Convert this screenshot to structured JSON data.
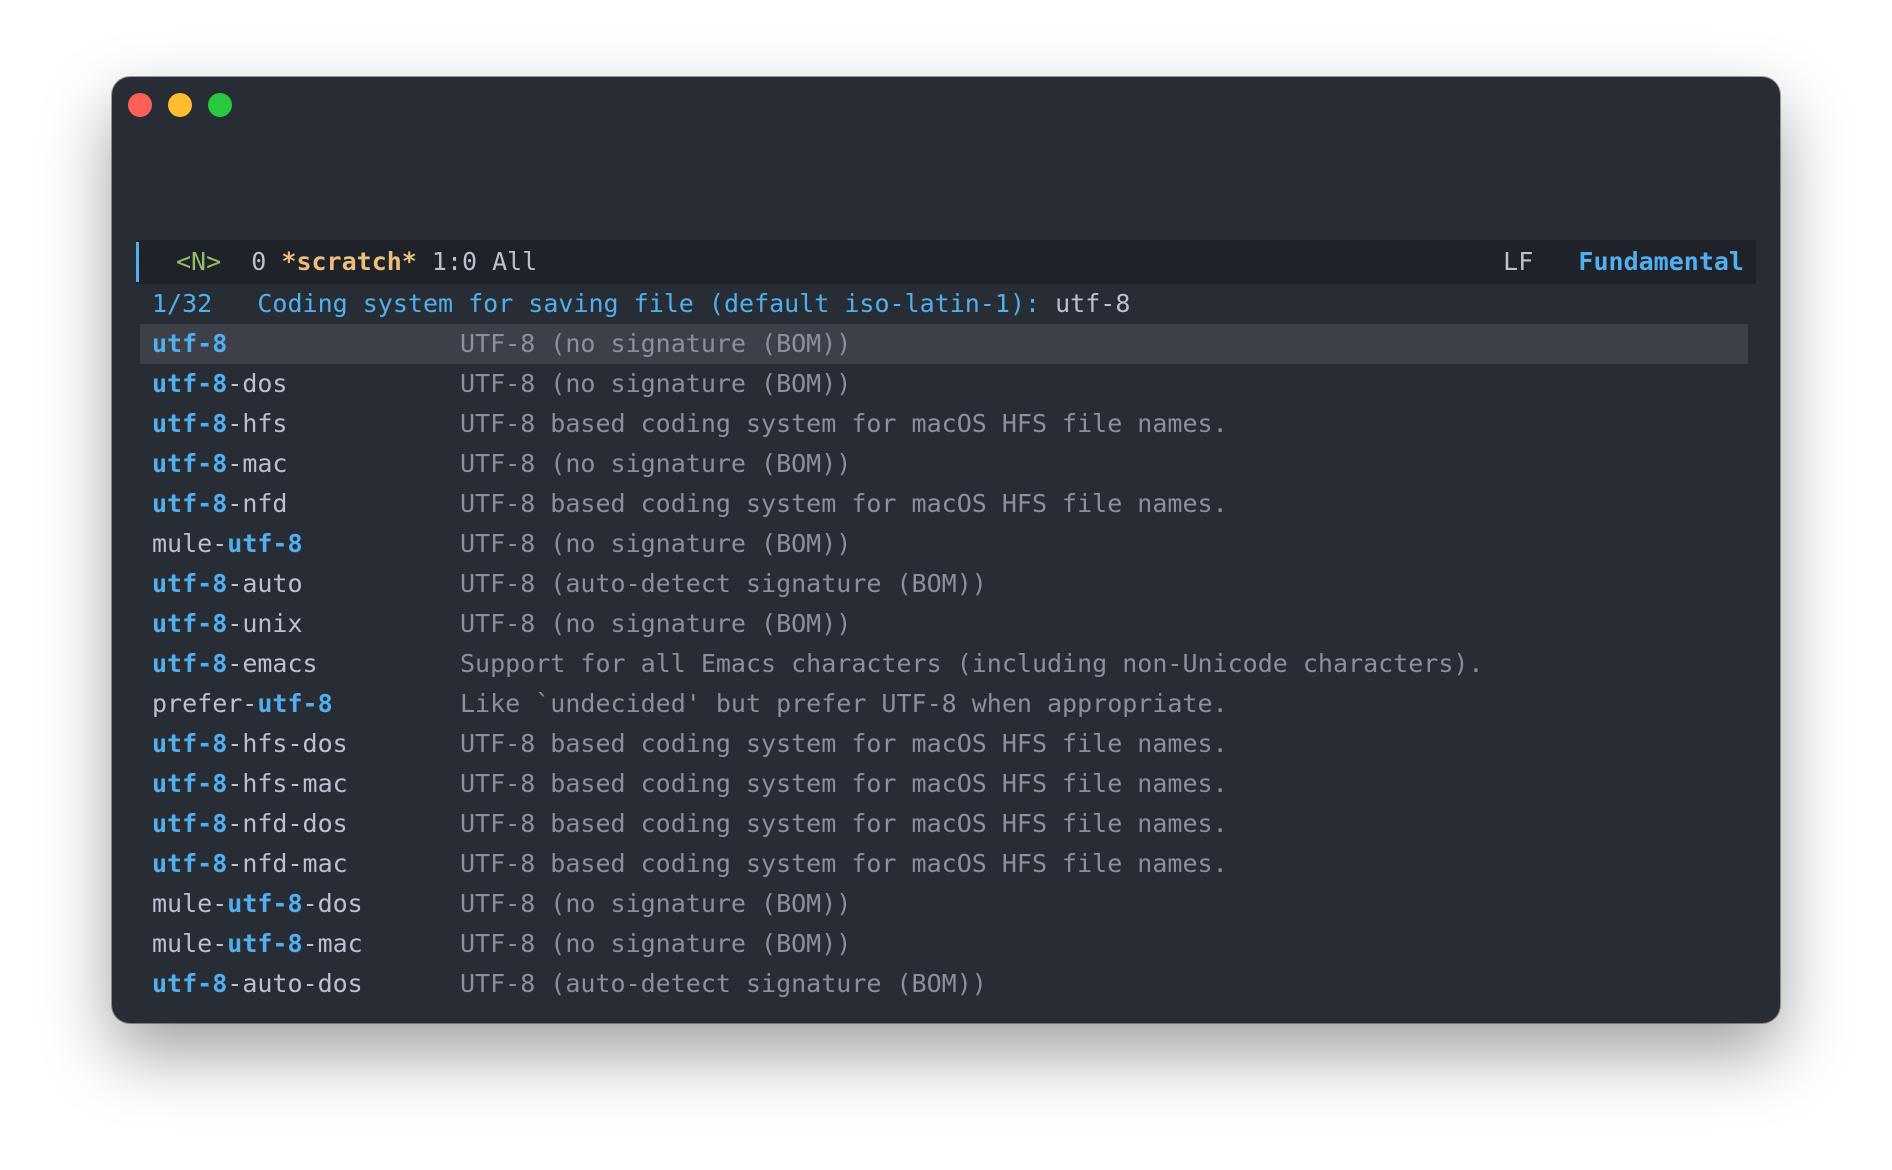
{
  "colors": {
    "background": "#282c34",
    "modeline": "#1f2228",
    "accent": "#51afef",
    "buffer_name": "#ecbe7b",
    "state": "#98be65",
    "selected_row": "#3e4049",
    "text": "#bbc2cf",
    "description": "#8b919b"
  },
  "window": {
    "controls": [
      "close",
      "minimize",
      "zoom"
    ]
  },
  "modeline": {
    "state": "<N>",
    "modified": "0",
    "buffer": "*scratch*",
    "position": "1:0 All",
    "eol": "LF",
    "major_mode": "Fundamental"
  },
  "minibuffer": {
    "count": "1/32",
    "prompt": "Coding system for saving file (default iso-latin-1):",
    "input": "utf-8"
  },
  "candidates": [
    {
      "pre": "",
      "match": "utf-8",
      "post": "",
      "desc": "UTF-8 (no signature (BOM))",
      "selected": true
    },
    {
      "pre": "",
      "match": "utf-8",
      "post": "-dos",
      "desc": "UTF-8 (no signature (BOM))"
    },
    {
      "pre": "",
      "match": "utf-8",
      "post": "-hfs",
      "desc": "UTF-8 based coding system for macOS HFS file names."
    },
    {
      "pre": "",
      "match": "utf-8",
      "post": "-mac",
      "desc": "UTF-8 (no signature (BOM))"
    },
    {
      "pre": "",
      "match": "utf-8",
      "post": "-nfd",
      "desc": "UTF-8 based coding system for macOS HFS file names."
    },
    {
      "pre": "mule-",
      "match": "utf-8",
      "post": "",
      "desc": "UTF-8 (no signature (BOM))"
    },
    {
      "pre": "",
      "match": "utf-8",
      "post": "-auto",
      "desc": "UTF-8 (auto-detect signature (BOM))"
    },
    {
      "pre": "",
      "match": "utf-8",
      "post": "-unix",
      "desc": "UTF-8 (no signature (BOM))"
    },
    {
      "pre": "",
      "match": "utf-8",
      "post": "-emacs",
      "desc": "Support for all Emacs characters (including non-Unicode characters)."
    },
    {
      "pre": "prefer-",
      "match": "utf-8",
      "post": "",
      "desc": "Like `undecided' but prefer UTF-8 when appropriate."
    },
    {
      "pre": "",
      "match": "utf-8",
      "post": "-hfs-dos",
      "desc": "UTF-8 based coding system for macOS HFS file names."
    },
    {
      "pre": "",
      "match": "utf-8",
      "post": "-hfs-mac",
      "desc": "UTF-8 based coding system for macOS HFS file names."
    },
    {
      "pre": "",
      "match": "utf-8",
      "post": "-nfd-dos",
      "desc": "UTF-8 based coding system for macOS HFS file names."
    },
    {
      "pre": "",
      "match": "utf-8",
      "post": "-nfd-mac",
      "desc": "UTF-8 based coding system for macOS HFS file names."
    },
    {
      "pre": "mule-",
      "match": "utf-8",
      "post": "-dos",
      "desc": "UTF-8 (no signature (BOM))"
    },
    {
      "pre": "mule-",
      "match": "utf-8",
      "post": "-mac",
      "desc": "UTF-8 (no signature (BOM))"
    },
    {
      "pre": "",
      "match": "utf-8",
      "post": "-auto-dos",
      "desc": "UTF-8 (auto-detect signature (BOM))"
    }
  ]
}
